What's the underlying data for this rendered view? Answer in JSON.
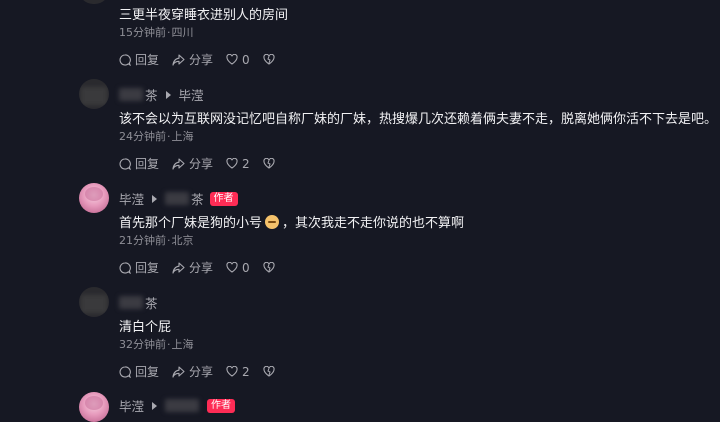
{
  "comments": [
    {
      "text": "三更半夜穿睡衣进别人的房间",
      "time": "15分钟前",
      "location": "四川",
      "reply_label": "回复",
      "share_label": "分享",
      "likes": "0"
    },
    {
      "author_suffix": "茶",
      "reply_to": "毕滢",
      "text": "该不会以为互联网没记忆吧自称厂妹的厂妹，热搜爆几次还赖着俩夫妻不走，脱离她俩你活不下去是吧。",
      "time": "24分钟前",
      "location": "上海",
      "reply_label": "回复",
      "share_label": "分享",
      "likes": "2"
    },
    {
      "author": "毕滢",
      "reply_to_suffix": "茶",
      "badge": "作者",
      "text_before": "首先那个厂妹是狗的小号",
      "text_after": "，其次我走不走你说的也不算啊",
      "time": "21分钟前",
      "location": "北京",
      "reply_label": "回复",
      "share_label": "分享",
      "likes": "0"
    },
    {
      "author_suffix": "茶",
      "text": "清白个屁",
      "time": "32分钟前",
      "location": "上海",
      "reply_label": "回复",
      "share_label": "分享",
      "likes": "2"
    },
    {
      "author": "毕滢",
      "badge": "作者"
    }
  ],
  "separator": "·",
  "colors": {
    "background": "#161823",
    "badge": "#fe2c55",
    "text": "#f2f2f4",
    "muted": "#8f8f97"
  }
}
